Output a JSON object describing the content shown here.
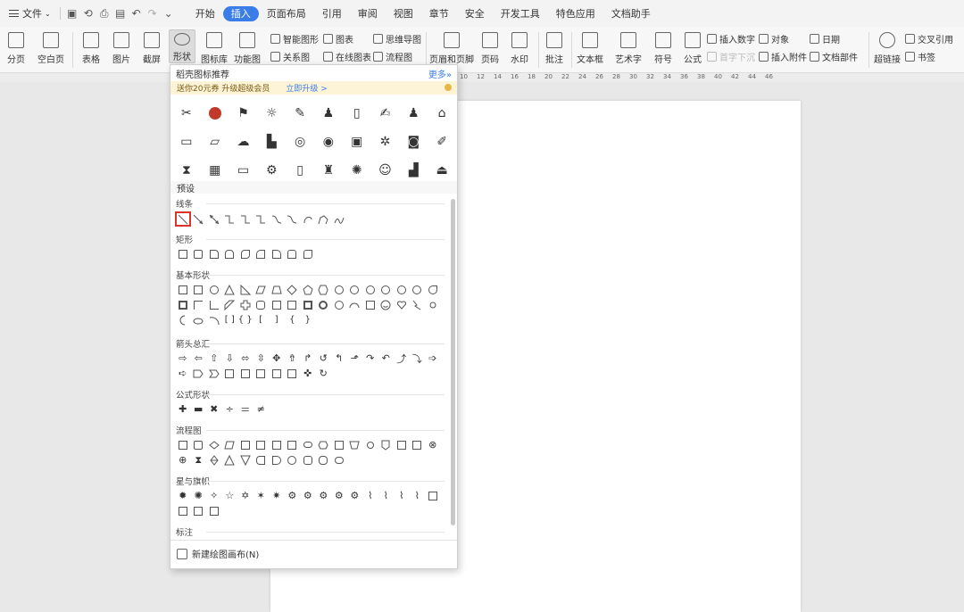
{
  "menubar": {
    "file_label": "文件",
    "tabs": [
      "开始",
      "插入",
      "页面布局",
      "引用",
      "审阅",
      "视图",
      "章节",
      "安全",
      "开发工具",
      "特色应用",
      "文档助手"
    ],
    "active_tab": "插入"
  },
  "ribbon": {
    "buttons": [
      "分页",
      "空白页",
      "表格",
      "图片",
      "截屏",
      "形状",
      "图标库",
      "功能图",
      "页眉和页脚",
      "页码",
      "水印",
      "批注",
      "文本框",
      "艺术字",
      "符号",
      "公式",
      "超链接"
    ],
    "small": [
      "智能图形",
      "图表",
      "思维导图",
      "关系图",
      "在线图表",
      "流程图",
      "插入数字",
      "对象",
      "日期",
      "首字下沉",
      "插入附件",
      "文档部件",
      "交叉引用",
      "书签"
    ]
  },
  "ruler": {
    "ticks": [
      "10",
      "12",
      "14",
      "16",
      "18",
      "20",
      "22",
      "24",
      "26",
      "28",
      "30",
      "32",
      "34",
      "36",
      "38",
      "40",
      "42",
      "44",
      "46"
    ]
  },
  "panel": {
    "header_title": "稻壳图标推荐",
    "more_label": "更多",
    "promo_text": "送你20元券 升级超级会员",
    "promo_link": "立即升级 >",
    "preset_label": "预设",
    "categories": [
      "线条",
      "矩形",
      "基本形状",
      "箭头总汇",
      "公式形状",
      "流程图",
      "星与旗帜",
      "标注"
    ],
    "footer_label": "新建绘图画布(N)"
  },
  "colors": {
    "accent": "#3b7de8",
    "highlight": "#d9342b",
    "promo_bg": "#fdf3d6"
  }
}
